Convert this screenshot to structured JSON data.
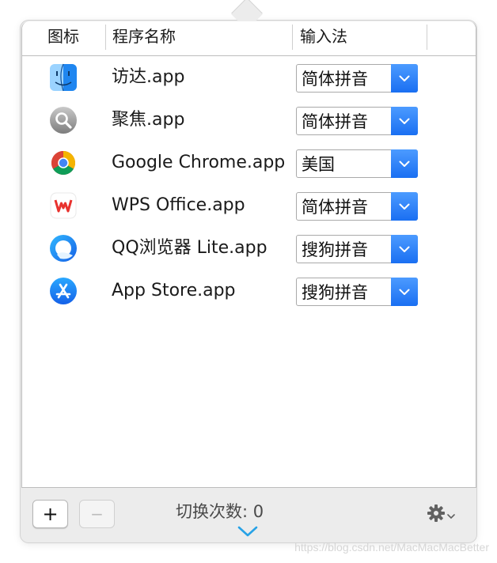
{
  "table": {
    "headers": {
      "icon": "图标",
      "name": "程序名称",
      "input_method": "输入法"
    },
    "rows": [
      {
        "app_name": "访达.app",
        "input_method": "简体拼音",
        "icon": "finder-icon"
      },
      {
        "app_name": "聚焦.app",
        "input_method": "简体拼音",
        "icon": "spotlight-icon"
      },
      {
        "app_name": "Google Chrome.app",
        "input_method": "美国",
        "icon": "chrome-icon"
      },
      {
        "app_name": "WPS Office.app",
        "input_method": "简体拼音",
        "icon": "wps-office-icon"
      },
      {
        "app_name": "QQ浏览器 Lite.app",
        "input_method": "搜狗拼音",
        "icon": "qq-browser-icon"
      },
      {
        "app_name": "App Store.app",
        "input_method": "搜狗拼音",
        "icon": "app-store-icon"
      }
    ]
  },
  "footer": {
    "add_label": "+",
    "remove_label": "−",
    "switch_count_label": "切换次数: 0"
  },
  "watermark": "https://blog.csdn.net/MacMacMacBetter",
  "colors": {
    "accent": "#1a6ff2",
    "popover_bg": "#ececec",
    "table_bg": "#ffffff"
  }
}
